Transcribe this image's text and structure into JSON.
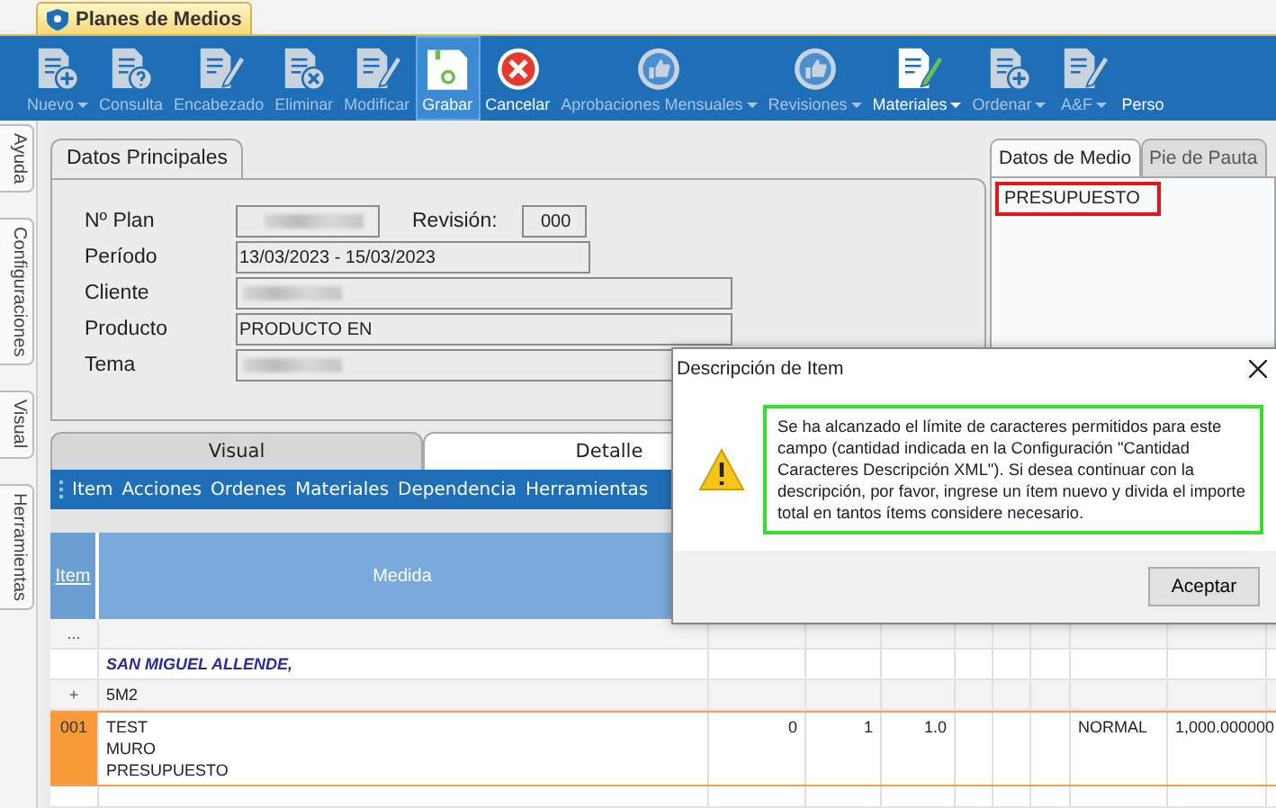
{
  "document_tab": {
    "label": "Planes de Medios"
  },
  "toolbar": [
    {
      "label": "Nuevo",
      "kind": "doc-plus",
      "enabled": false,
      "dropdown": true,
      "selected": false
    },
    {
      "label": "Consulta",
      "kind": "doc-question",
      "enabled": false,
      "dropdown": false,
      "selected": false
    },
    {
      "label": "Encabezado",
      "kind": "doc-pencil",
      "enabled": false,
      "dropdown": false,
      "selected": false
    },
    {
      "label": "Eliminar",
      "kind": "doc-x",
      "enabled": false,
      "dropdown": false,
      "selected": false
    },
    {
      "label": "Modificar",
      "kind": "doc-pencil",
      "enabled": false,
      "dropdown": false,
      "selected": false
    },
    {
      "label": "Grabar",
      "kind": "floppy",
      "enabled": true,
      "dropdown": false,
      "selected": true
    },
    {
      "label": "Cancelar",
      "kind": "cancel",
      "enabled": true,
      "dropdown": false,
      "selected": false
    },
    {
      "label": "Aprobaciones Mensuales",
      "kind": "thumbs-up",
      "enabled": false,
      "dropdown": true,
      "selected": false
    },
    {
      "label": "Revisiones",
      "kind": "thumbs-up",
      "enabled": false,
      "dropdown": true,
      "selected": false
    },
    {
      "label": "Materiales",
      "kind": "doc-pencil-green",
      "enabled": true,
      "dropdown": true,
      "selected": false
    },
    {
      "label": "Ordenar",
      "kind": "doc-plus",
      "enabled": false,
      "dropdown": true,
      "selected": false
    },
    {
      "label": "A&F",
      "kind": "doc-pencil",
      "enabled": false,
      "dropdown": true,
      "selected": false
    },
    {
      "label": "Perso",
      "kind": "none",
      "enabled": true,
      "dropdown": false,
      "selected": false
    }
  ],
  "side_tabs": [
    "Ayuda",
    "Configuraciones",
    "Visual",
    "Herramientas"
  ],
  "main_panel": {
    "tab": "Datos Principales",
    "fields": [
      {
        "label": "Nº Plan",
        "redacted": true
      },
      {
        "label": "Período",
        "value": "13/03/2023 - 15/03/2023",
        "redacted": false
      },
      {
        "label": "Cliente",
        "redacted": true
      },
      {
        "label": "Producto",
        "value": "PRODUCTO EN",
        "redacted": false
      },
      {
        "label": "Tema",
        "redacted": true
      }
    ],
    "revision": {
      "label": "Revisión:",
      "value": "000"
    }
  },
  "side_panel": {
    "tabs": [
      {
        "label": "Datos de Medio",
        "selected": true
      },
      {
        "label": "Pie de Pauta",
        "selected": false
      }
    ],
    "value": "PRESUPUESTO",
    "highlighted": true
  },
  "detail_tabs": [
    {
      "label": "Visual",
      "selected": false
    },
    {
      "label": "Detalle",
      "selected": true
    }
  ],
  "menu": [
    "Item",
    "Acciones",
    "Ordenes",
    "Materiales",
    "Dependencia",
    "Herramientas"
  ],
  "table": {
    "columns": [
      "Item",
      "Medida"
    ],
    "rows": [
      {
        "kind": "filter",
        "item": "...",
        "medida": [],
        "cells": [],
        "selected": false
      },
      {
        "kind": "group",
        "medida": [
          "SAN MIGUEL ALLENDE,"
        ],
        "cells": [],
        "selected": false
      },
      {
        "kind": "subgroup",
        "item": "+",
        "medida": [
          "5M2"
        ],
        "cells": [],
        "selected": false
      },
      {
        "kind": "item",
        "item": "001",
        "medida": [
          "TEST",
          "MURO",
          "PRESUPUESTO"
        ],
        "cells": [
          "0",
          "1",
          "1.0",
          null,
          null,
          null,
          "NORMAL",
          "1,000.000000"
        ],
        "selected": true
      }
    ]
  },
  "dialog": {
    "title": "Descripción de Item",
    "message": "Se ha alcanzado el límite de caracteres permitidos para este campo (cantidad indicada en la Configuración \"Cantidad Caracteres Descripción XML\"). Si desea continuar con la descripción, por favor, ingrese un ítem nuevo y divida el importe total en tantos ítems considere necesario.",
    "message_highlighted": true,
    "button": "Aceptar"
  }
}
